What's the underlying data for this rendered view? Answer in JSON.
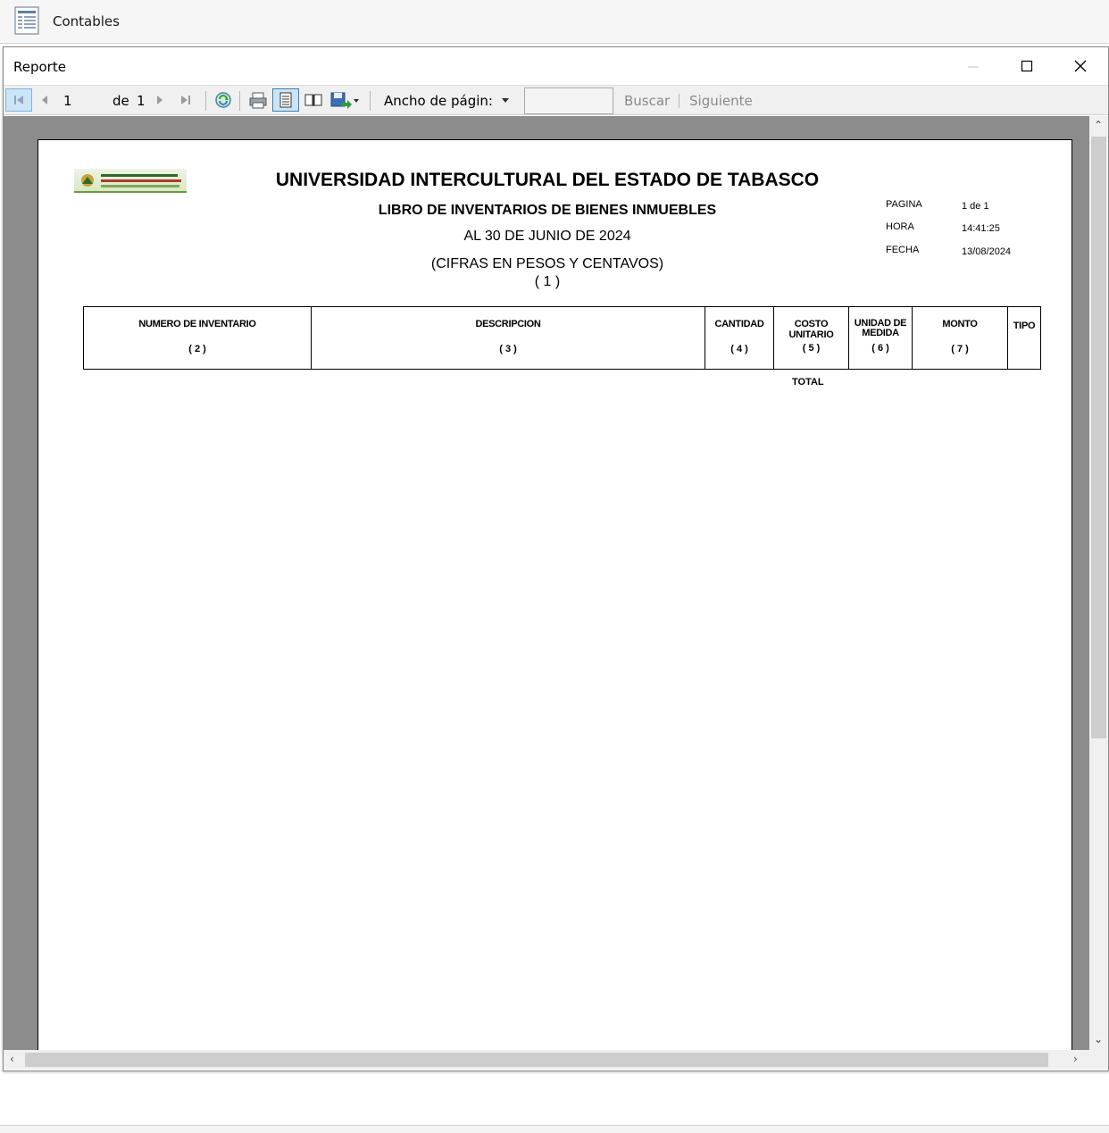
{
  "app": {
    "title": "Contables"
  },
  "window": {
    "title": "Reporte"
  },
  "toolbar": {
    "current_page": "1",
    "of_label": "de",
    "total_pages": "1",
    "zoom": "Ancho de págin:",
    "search_value": "",
    "find_label": "Buscar",
    "find_next_label": "Siguiente"
  },
  "report": {
    "institution": "UNIVERSIDAD INTERCULTURAL DEL ESTADO DE TABASCO",
    "book_title": "LIBRO DE INVENTARIOS DE BIENES INMUEBLES",
    "as_of": "AL 30 DE JUNIO  DE 2024",
    "figures_note": "(CIFRAS EN PESOS Y CENTAVOS)",
    "ref": "( 1 )",
    "meta": [
      {
        "label": "PAGINA",
        "value": "1 de 1"
      },
      {
        "label": "HORA",
        "value": "14:41:25"
      },
      {
        "label": "FECHA",
        "value": "13/08/2024"
      }
    ],
    "columns": [
      {
        "header": "NUMERO DE INVENTARIO",
        "ref": "( 2 )"
      },
      {
        "header": "DESCRIPCION",
        "ref": "( 3 )"
      },
      {
        "header": "CANTIDAD",
        "ref": "( 4 )"
      },
      {
        "header": "COSTO UNITARIO",
        "ref": "( 5 )"
      },
      {
        "header": "UNIDAD DE MEDIDA",
        "ref": "( 6 )"
      },
      {
        "header": "MONTO",
        "ref": "( 7 )"
      },
      {
        "header": "TIPO",
        "ref": ""
      }
    ],
    "total_label": "TOTAL"
  },
  "icons": {
    "app": "report-document-icon",
    "first": "first-page-icon",
    "prev": "previous-page-icon",
    "next": "next-page-icon",
    "last": "last-page-icon",
    "refresh": "refresh-icon",
    "print": "print-icon",
    "print_layout": "print-layout-icon",
    "page_setup": "page-setup-icon",
    "export": "export-save-icon"
  },
  "colors": {
    "accent": "#3c7fb1",
    "viewport_bg": "#8c8c8c",
    "logo_green": "#6a9b3a"
  }
}
